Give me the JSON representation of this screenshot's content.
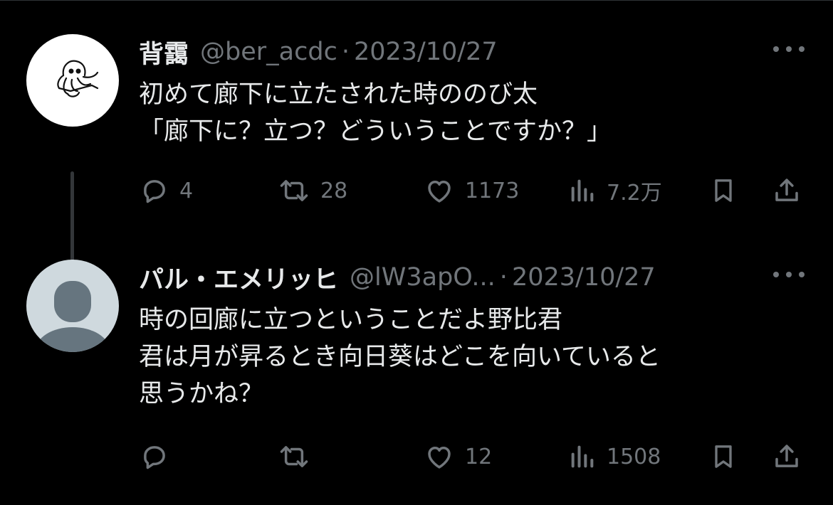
{
  "tweets": [
    {
      "name": "背靄",
      "handle": "@ber_acdc",
      "separator": "·",
      "date": "2023/10/27",
      "lines": [
        "初めて廊下に立たされた時ののび太",
        "「廊下に？立つ？どういうことですか？」"
      ],
      "stats": {
        "replies": "4",
        "retweets": "28",
        "likes": "1173",
        "views": "7.2万"
      }
    },
    {
      "name": "パル・エメリッヒ",
      "handle": "@lW3apO...",
      "separator": "·",
      "date": "2023/10/27",
      "lines": [
        "時の回廊に立つということだよ野比君",
        "君は月が昇るとき向日葵はどこを向いていると",
        "思うかね？"
      ],
      "stats": {
        "replies": "",
        "retweets": "",
        "likes": "12",
        "views": "1508"
      }
    }
  ],
  "icons": {
    "avatar1": "squid-doodle-avatar",
    "avatar2": "default-profile-avatar",
    "more": "more-dots-icon",
    "reply": "reply-icon",
    "retweet": "retweet-icon",
    "like": "heart-icon",
    "views": "views-icon",
    "bookmark": "bookmark-icon",
    "share": "share-icon"
  },
  "colors": {
    "background": "#000000",
    "primary_text": "#e7e9ea",
    "secondary_text": "#71767b",
    "divider": "#2f3336"
  }
}
